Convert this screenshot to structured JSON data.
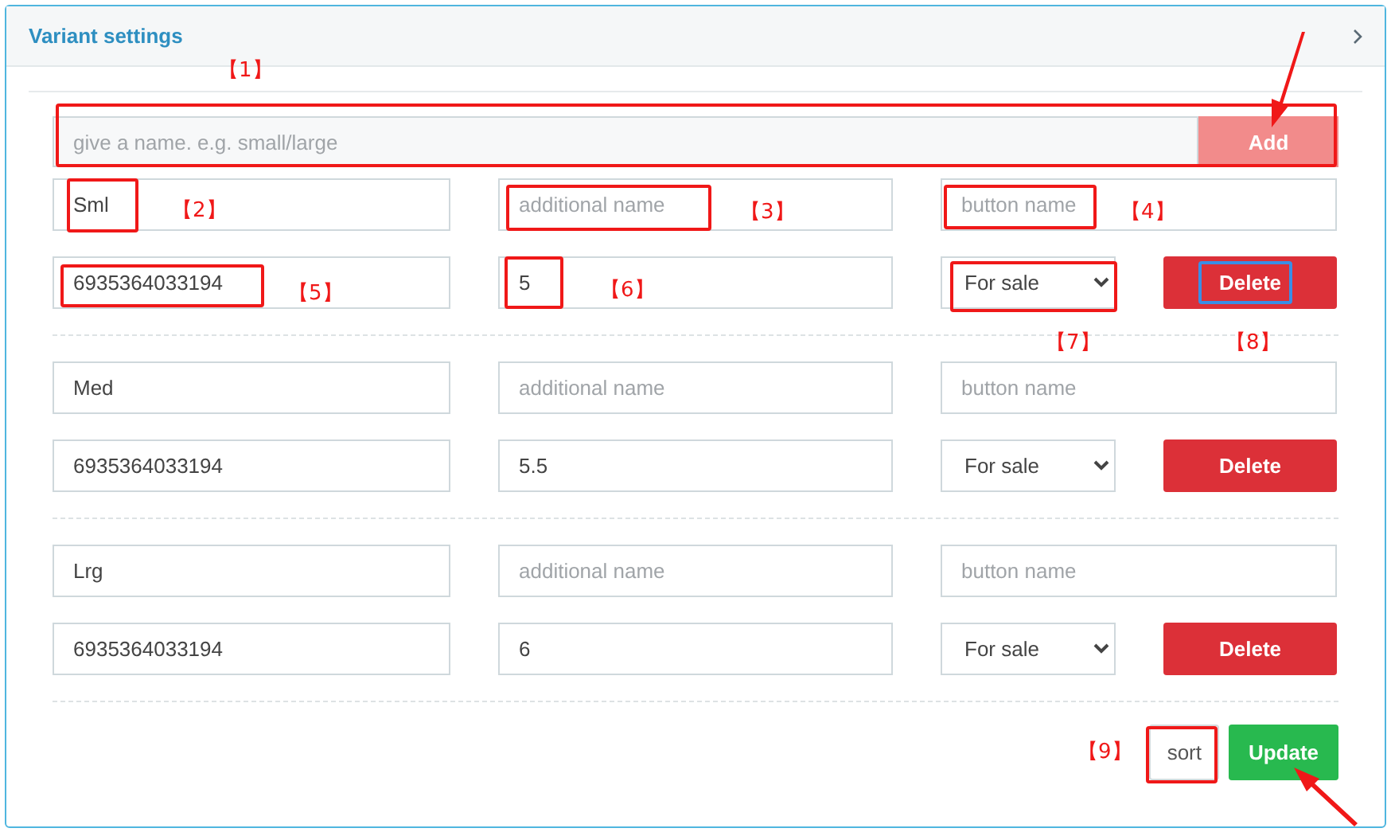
{
  "panel": {
    "title": "Variant settings"
  },
  "new_variant": {
    "placeholder": "give a name. e.g. small/large",
    "button": "Add"
  },
  "variants": [
    {
      "name": "Sml",
      "additional_placeholder": "additional name",
      "button_placeholder": "button name",
      "barcode": "6935364033194",
      "price": "5",
      "status": "For sale",
      "delete": "Delete"
    },
    {
      "name": "Med",
      "additional_placeholder": "additional name",
      "button_placeholder": "button name",
      "barcode": "6935364033194",
      "price": "5.5",
      "status": "For sale",
      "delete": "Delete"
    },
    {
      "name": "Lrg",
      "additional_placeholder": "additional name",
      "button_placeholder": "button name",
      "barcode": "6935364033194",
      "price": "6",
      "status": "For sale",
      "delete": "Delete"
    }
  ],
  "footer": {
    "sort": "sort",
    "update": "Update"
  },
  "annotations": [
    {
      "label": "【1】"
    },
    {
      "label": "【2】"
    },
    {
      "label": "【3】"
    },
    {
      "label": "【4】"
    },
    {
      "label": "【5】"
    },
    {
      "label": "【6】"
    },
    {
      "label": "【7】"
    },
    {
      "label": "【8】"
    },
    {
      "label": "【9】"
    }
  ]
}
